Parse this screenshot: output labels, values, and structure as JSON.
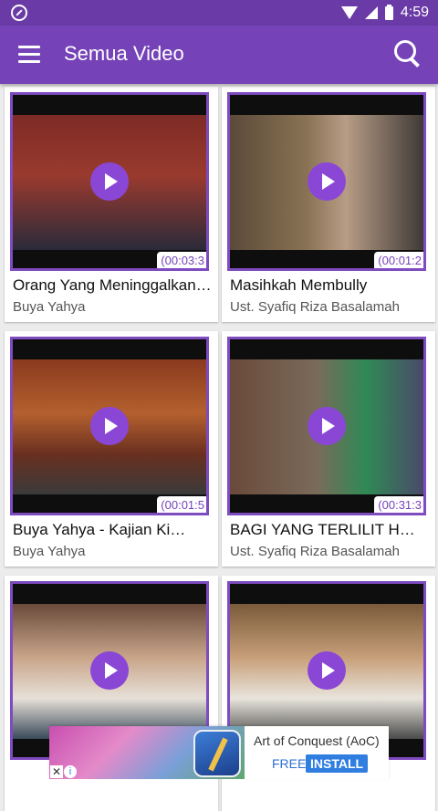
{
  "status_bar": {
    "time": "4:59"
  },
  "app_bar": {
    "title": "Semua Video"
  },
  "videos": [
    {
      "title": "Orang Yang Meninggalkan…",
      "author": "Buya Yahya",
      "duration": "(00:03:3"
    },
    {
      "title": "Masihkah Membully",
      "author": "Ust. Syafiq Riza Basalamah",
      "duration": "(00:01:2"
    },
    {
      "title": "Buya Yahya - Kajian Ki…",
      "author": "Buya Yahya",
      "duration": "(00:01:5"
    },
    {
      "title": "BAGI YANG TERLILIT H…",
      "author": "Ust. Syafiq Riza Basalamah",
      "duration": "(00:31:3"
    },
    {
      "title": "",
      "author": "",
      "duration": ""
    },
    {
      "title": "",
      "author": "",
      "duration": ""
    }
  ],
  "ad": {
    "title": "Art of Conquest (AoC)",
    "free_label": "FREE",
    "install_label": "INSTALL",
    "close_glyph": "✕",
    "info_glyph": "i"
  },
  "colors": {
    "primary": "#7542b8",
    "status_bar": "#6a3aa6",
    "play_button": "#8a47d6",
    "install_button": "#2f7ee0"
  }
}
